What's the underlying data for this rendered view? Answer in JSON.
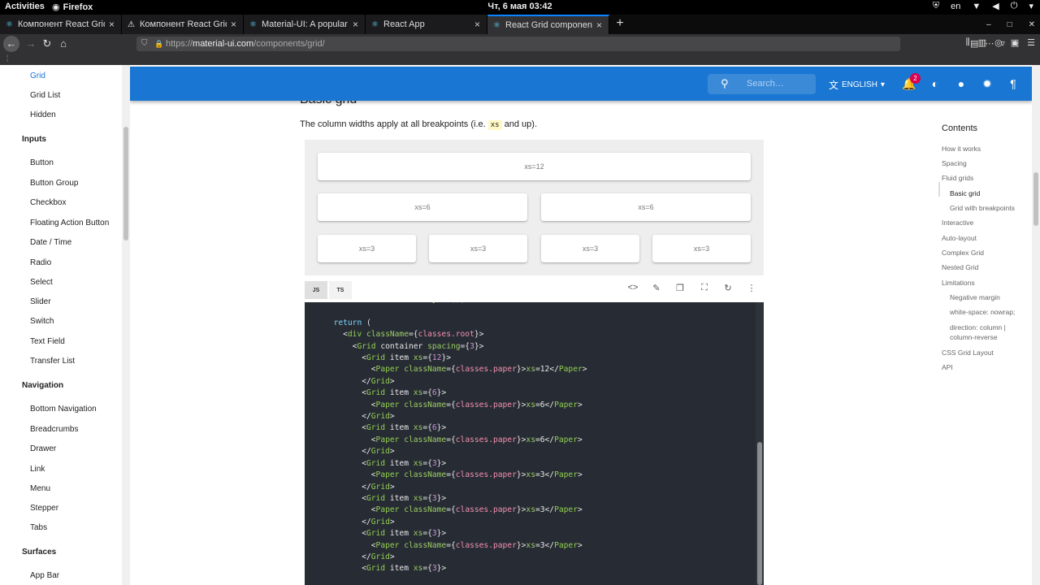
{
  "system_bar": {
    "activities": "Activities",
    "app": "Firefox",
    "clock": "Чт, 6 мая  03:42",
    "lang": "en"
  },
  "tabs": [
    {
      "label": "Компонент React Grid",
      "icon": "react-icon"
    },
    {
      "label": "Компонент React Grid",
      "icon": "warning-icon"
    },
    {
      "label": "Material-UI: A popular",
      "icon": "react-icon"
    },
    {
      "label": "React App",
      "icon": "react-icon"
    },
    {
      "label": "React Grid component",
      "icon": "react-icon",
      "active": true
    }
  ],
  "url": {
    "scheme": "https://",
    "host": "material-ui.com",
    "path": "/components/grid/"
  },
  "sidebar": {
    "items_top": [
      "Grid",
      "Grid List",
      "Hidden"
    ],
    "inputs_header": "Inputs",
    "inputs": [
      "Button",
      "Button Group",
      "Checkbox",
      "Floating Action Button",
      "Date / Time",
      "Radio",
      "Select",
      "Slider",
      "Switch",
      "Text Field",
      "Transfer List"
    ],
    "navigation_header": "Navigation",
    "navigation": [
      "Bottom Navigation",
      "Breadcrumbs",
      "Drawer",
      "Link",
      "Menu",
      "Stepper",
      "Tabs"
    ],
    "surfaces_header": "Surfaces",
    "surfaces": [
      "App Bar"
    ]
  },
  "appbar": {
    "search_placeholder": "Search…",
    "language": "ENGLISH",
    "notifications_count": "2",
    "accent": "#1976d2"
  },
  "content": {
    "heading": "Basic grid",
    "desc_before": "The column widths apply at all breakpoints (i.e. ",
    "desc_code": "xs",
    "desc_after": " and up).",
    "papers": [
      "xs=12",
      "xs=6",
      "xs=6",
      "xs=3",
      "xs=3",
      "xs=3",
      "xs=3"
    ],
    "lang_tabs": [
      "JS",
      "TS"
    ]
  },
  "code_lines": [
    "  const classes = useStyles();",
    "",
    "  return (",
    "    <div className={classes.root}>",
    "      <Grid container spacing={3}>",
    "        <Grid item xs={12}>",
    "          <Paper className={classes.paper}>xs=12</Paper>",
    "        </Grid>",
    "        <Grid item xs={6}>",
    "          <Paper className={classes.paper}>xs=6</Paper>",
    "        </Grid>",
    "        <Grid item xs={6}>",
    "          <Paper className={classes.paper}>xs=6</Paper>",
    "        </Grid>",
    "        <Grid item xs={3}>",
    "          <Paper className={classes.paper}>xs=3</Paper>",
    "        </Grid>",
    "        <Grid item xs={3}>",
    "          <Paper className={classes.paper}>xs=3</Paper>",
    "        </Grid>",
    "        <Grid item xs={3}>",
    "          <Paper className={classes.paper}>xs=3</Paper>",
    "        </Grid>",
    "        <Grid item xs={3}>"
  ],
  "toc": {
    "title": "Contents",
    "items": [
      {
        "label": "How it works",
        "level": 0
      },
      {
        "label": "Spacing",
        "level": 0
      },
      {
        "label": "Fluid grids",
        "level": 0
      },
      {
        "label": "Basic grid",
        "level": 1,
        "active": true
      },
      {
        "label": "Grid with breakpoints",
        "level": 1
      },
      {
        "label": "Interactive",
        "level": 0
      },
      {
        "label": "Auto-layout",
        "level": 0
      },
      {
        "label": "Complex Grid",
        "level": 0
      },
      {
        "label": "Nested Grid",
        "level": 0
      },
      {
        "label": "Limitations",
        "level": 0
      },
      {
        "label": "Negative margin",
        "level": 1
      },
      {
        "label": "white-space: nowrap;",
        "level": 1
      },
      {
        "label": "direction: column |",
        "level": 1
      },
      {
        "label": "column-reverse",
        "level": 1
      },
      {
        "label": "CSS Grid Layout",
        "level": 0
      },
      {
        "label": "API",
        "level": 0
      }
    ]
  }
}
